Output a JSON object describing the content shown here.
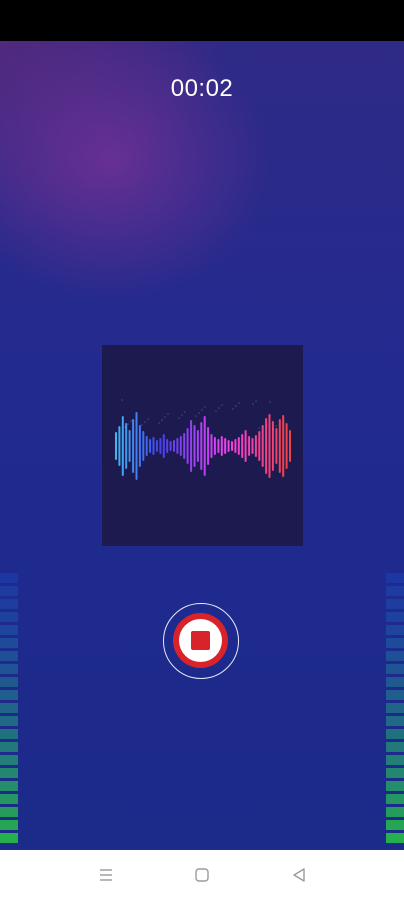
{
  "recorder": {
    "elapsed_time": "00:02"
  },
  "colors": {
    "record_red": "#d9232a",
    "card_bg": "#1c1a4e"
  },
  "icons": {
    "stop": "stop-icon",
    "menu": "menu-icon",
    "home": "home-icon",
    "back": "back-icon"
  }
}
